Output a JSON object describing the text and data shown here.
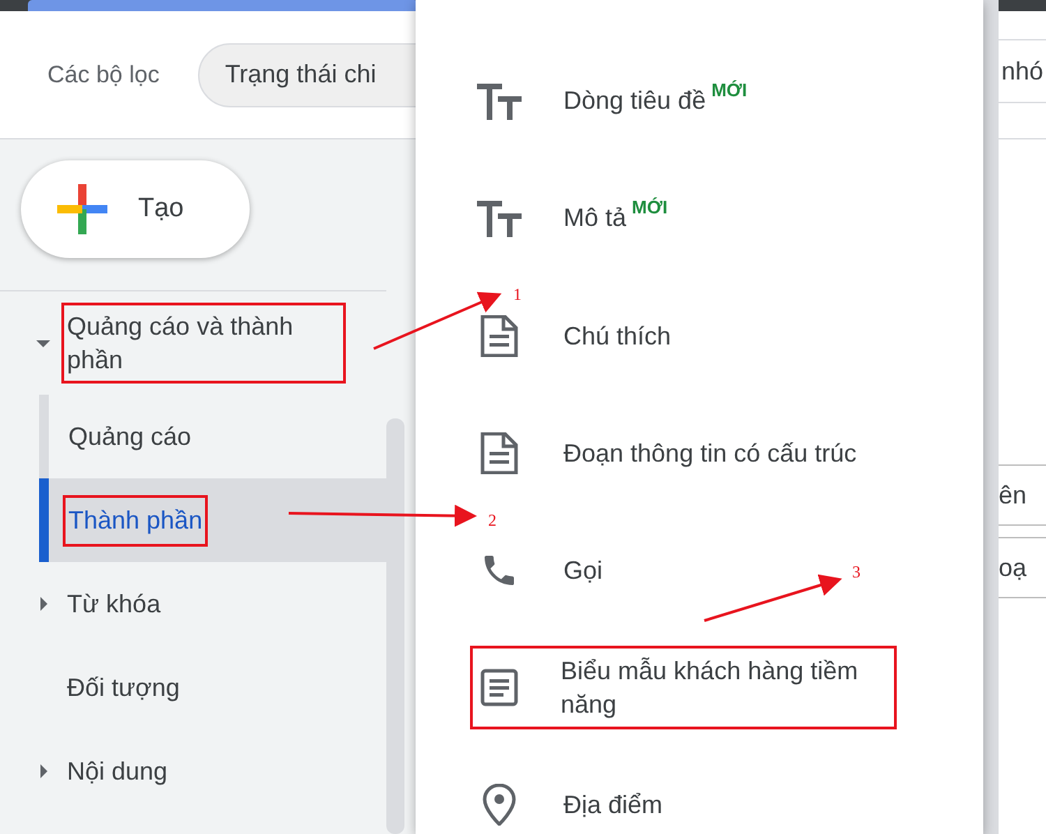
{
  "filter_bar": {
    "label": "Các bộ lọc",
    "chip": "Trạng thái chi",
    "chip_right": "nhó"
  },
  "create_button": {
    "label": "Tạo"
  },
  "sidebar": {
    "items": [
      {
        "label": "Quảng cáo và thành phần",
        "expandable": true,
        "expanded": true,
        "marked": true,
        "children": [
          {
            "label": "Quảng cáo",
            "selected": false,
            "marked": false
          },
          {
            "label": "Thành phần",
            "selected": true,
            "marked": true
          }
        ]
      },
      {
        "label": "Từ khóa",
        "expandable": true,
        "expanded": false,
        "marked": false
      },
      {
        "label": "Đối tượng",
        "expandable": false,
        "marked": false
      },
      {
        "label": "Nội dung",
        "expandable": true,
        "expanded": false,
        "marked": false
      }
    ]
  },
  "menu": {
    "items": [
      {
        "kind": "text",
        "label": "Dòng tiêu đề",
        "badge": "MỚI",
        "marked": false
      },
      {
        "kind": "text",
        "label": "Mô tả",
        "badge": "MỚI",
        "marked": false
      },
      {
        "kind": "doc",
        "label": "Chú thích",
        "marked": false
      },
      {
        "kind": "doc",
        "label": "Đoạn thông tin có cấu trúc",
        "marked": false
      },
      {
        "kind": "phone",
        "label": "Gọi",
        "marked": false
      },
      {
        "kind": "form",
        "label": "Biểu mẫu khách hàng tiềm năng",
        "marked": true
      },
      {
        "kind": "pin",
        "label": "Địa điểm",
        "marked": false
      }
    ]
  },
  "right_panel": {
    "rows": [
      "ên",
      "oạ"
    ]
  },
  "annotations": [
    {
      "label": "1"
    },
    {
      "label": "2"
    },
    {
      "label": "3"
    }
  ]
}
